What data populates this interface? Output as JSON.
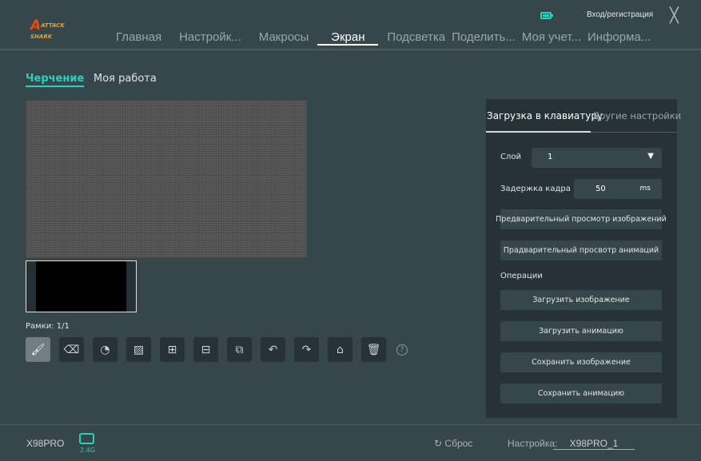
{
  "header": {
    "logo_text": "ATTACK SHARK",
    "login": "Вход/регистрация",
    "nav": [
      "Главная",
      "Настройк...",
      "Макросы",
      "Экран",
      "Подсветка",
      "Поделить...",
      "Моя учет...",
      "Информа..."
    ],
    "active_nav": "Экран"
  },
  "subtabs": [
    "Черчение",
    "Моя работа"
  ],
  "frames_label": "Рамки: 1/1",
  "tools": [
    "brush",
    "eraser",
    "palette",
    "image-add",
    "frame-add",
    "frame-remove",
    "frame-copy",
    "undo",
    "redo",
    "clear",
    "delete"
  ],
  "panel": {
    "tabs": [
      "Загрузка в клавиатуру",
      "Другие настройки"
    ],
    "layer_label": "Слой",
    "layer_value": "1",
    "delay_label": "Задержка кадра",
    "delay_value": "50",
    "delay_unit": "ms",
    "preview_image": "Предварительный просмотр изображений",
    "preview_anim": "Прадварительный просвотр анимаций",
    "operations": "Операции",
    "buttons": [
      "Загрузить изображение",
      "Загрузить анимацию",
      "Сохранить изображение",
      "Сохранить анимацию"
    ]
  },
  "footer": {
    "device": "X98PRO",
    "connection": "2.4G",
    "reset": "Сброс",
    "setting_label": "Настройка:",
    "setting_value": "X98PRO_1"
  },
  "colors": {
    "accent": "#2ad0c0",
    "bg": "#36474b",
    "panel": "#263236"
  }
}
